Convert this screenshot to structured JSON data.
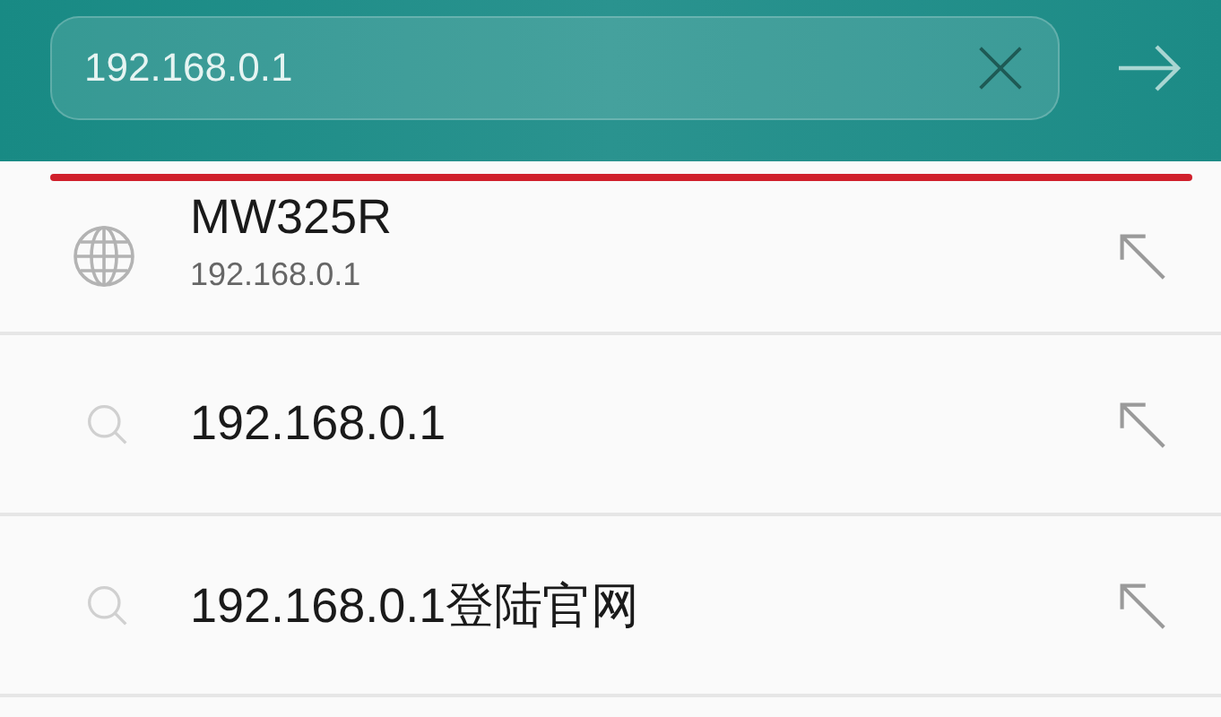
{
  "address_bar": {
    "value": "192.168.0.1"
  },
  "suggestions": [
    {
      "kind": "site",
      "title": "MW325R",
      "subtitle": "192.168.0.1"
    },
    {
      "kind": "search",
      "title": "192.168.0.1"
    },
    {
      "kind": "search",
      "title": "192.168.0.1登陆官网"
    }
  ]
}
